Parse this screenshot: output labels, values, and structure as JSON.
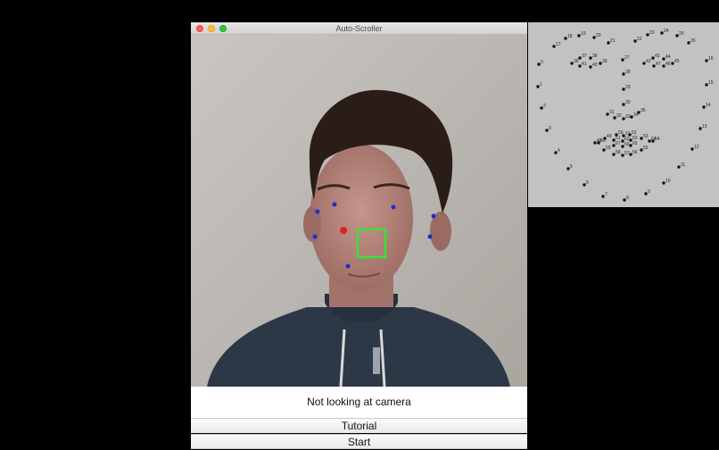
{
  "window": {
    "title": "Auto-Scroller",
    "status_text": "Not looking at camera",
    "tutorial_label": "Tutorial",
    "start_label": "Start"
  },
  "overlay": {
    "point_color": "#1f2bd8",
    "nose_color": "#e02020",
    "box_color": "#38e23a"
  },
  "landmarks": {
    "points": [
      {
        "label": "0"
      },
      {
        "label": "1"
      },
      {
        "label": "2"
      },
      {
        "label": "3"
      },
      {
        "label": "4"
      },
      {
        "label": "5"
      },
      {
        "label": "6"
      },
      {
        "label": "7"
      },
      {
        "label": "8"
      },
      {
        "label": "9"
      },
      {
        "label": "10"
      },
      {
        "label": "11"
      },
      {
        "label": "12"
      },
      {
        "label": "13"
      },
      {
        "label": "14"
      },
      {
        "label": "15"
      },
      {
        "label": "16"
      },
      {
        "label": "17"
      },
      {
        "label": "18"
      },
      {
        "label": "19"
      },
      {
        "label": "20"
      },
      {
        "label": "21"
      },
      {
        "label": "22"
      },
      {
        "label": "23"
      },
      {
        "label": "24"
      },
      {
        "label": "25"
      },
      {
        "label": "26"
      },
      {
        "label": "27"
      },
      {
        "label": "28"
      },
      {
        "label": "29"
      },
      {
        "label": "30"
      },
      {
        "label": "31"
      },
      {
        "label": "32"
      },
      {
        "label": "33"
      },
      {
        "label": "34"
      },
      {
        "label": "35"
      },
      {
        "label": "36"
      },
      {
        "label": "37"
      },
      {
        "label": "38"
      },
      {
        "label": "39"
      },
      {
        "label": "40"
      },
      {
        "label": "41"
      },
      {
        "label": "42"
      },
      {
        "label": "43"
      },
      {
        "label": "44"
      },
      {
        "label": "45"
      },
      {
        "label": "46"
      },
      {
        "label": "47"
      },
      {
        "label": "48"
      },
      {
        "label": "49"
      },
      {
        "label": "50"
      },
      {
        "label": "51"
      },
      {
        "label": "52"
      },
      {
        "label": "53"
      },
      {
        "label": "54"
      },
      {
        "label": "55"
      },
      {
        "label": "56"
      },
      {
        "label": "57"
      },
      {
        "label": "58"
      },
      {
        "label": "59"
      },
      {
        "label": "60"
      },
      {
        "label": "61"
      },
      {
        "label": "62"
      },
      {
        "label": "63"
      },
      {
        "label": "64"
      },
      {
        "label": "65"
      },
      {
        "label": "66"
      },
      {
        "label": "67"
      }
    ]
  }
}
